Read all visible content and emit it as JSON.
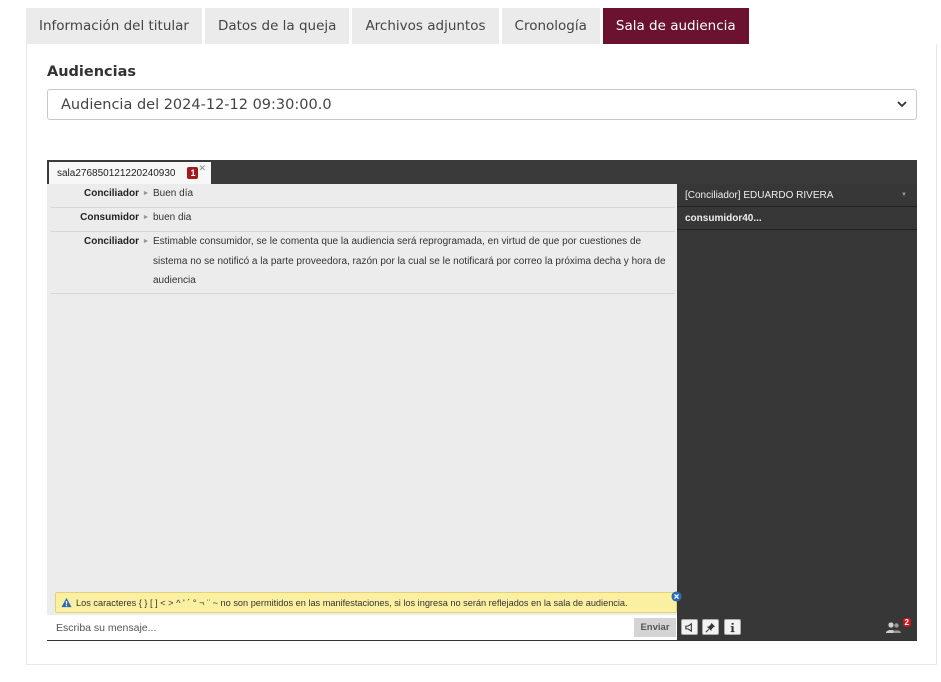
{
  "tabs": [
    {
      "label": "Información del titular",
      "active": false
    },
    {
      "label": "Datos de la queja",
      "active": false
    },
    {
      "label": "Archivos adjuntos",
      "active": false
    },
    {
      "label": "Cronología",
      "active": false
    },
    {
      "label": "Sala de audiencia",
      "active": true
    }
  ],
  "audiencias": {
    "title": "Audiencias",
    "selected": "Audiencia del 2024-12-12 09:30:00.0"
  },
  "chat": {
    "room_tab": {
      "label": "sala276850121220240930",
      "badge": "1"
    },
    "messages": [
      {
        "author": "Conciliador",
        "text": "Buen día"
      },
      {
        "author": "Consumidor",
        "text": "buen dia"
      },
      {
        "author": "Conciliador",
        "text": "Estimable consumidor, se le comenta que la audiencia será reprogramada, en virtud de que por cuestiones de sistema no se notificó a la parte proveedora, razón por la cual se le notificará por correo la próxima decha y hora de audiencia"
      }
    ],
    "users": [
      {
        "label": "[Conciliador] EDUARDO RIVERA"
      },
      {
        "label": "consumidor40..."
      }
    ],
    "warning": "Los caracteres { } [ ] < > ^ ' ´ ° ¬ ¨ ~ no son permitidos en las manifestaciones, si los ingresa no serán reflejados en la sala de audiencia.",
    "input_placeholder": "Escriba su mensaje...",
    "send_label": "Enviar",
    "participants_count": "2"
  },
  "colors": {
    "accent": "#6b1231",
    "chat_sidebar": "#373737",
    "warning_bg": "#fbf0a2",
    "badge": "#a01c1c"
  },
  "icons": [
    "chevron-down-icon",
    "close-icon",
    "warning-icon",
    "dismiss-icon",
    "speaker-icon",
    "pin-icon",
    "info-icon",
    "participants-icon"
  ]
}
